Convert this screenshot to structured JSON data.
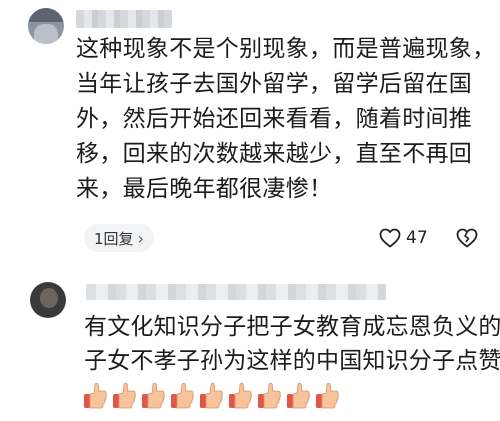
{
  "comment1": {
    "lines": [
      "这种现象不是个别现象，而是普遍现象，",
      "当年让孩子去国外留学，留学后留在国",
      "外，然后开始还回来看看，随着时间推",
      "移，回来的次数越来越少，直至不再回",
      "来，最后晚年都很凄惨！"
    ],
    "reply_label": "1回复",
    "reply_chevron": "›",
    "like_count": "47",
    "icons": {
      "like": "heart-icon",
      "dislike": "broken-heart-icon"
    }
  },
  "comment2": {
    "lines": [
      "有文化知识分子把子女教育成忘恩负义的",
      "子女不孝子孙为这样的中国知识分子点赞"
    ],
    "thumbs_count": 9,
    "icons": {
      "reaction": "thumbs-up-icon"
    }
  }
}
